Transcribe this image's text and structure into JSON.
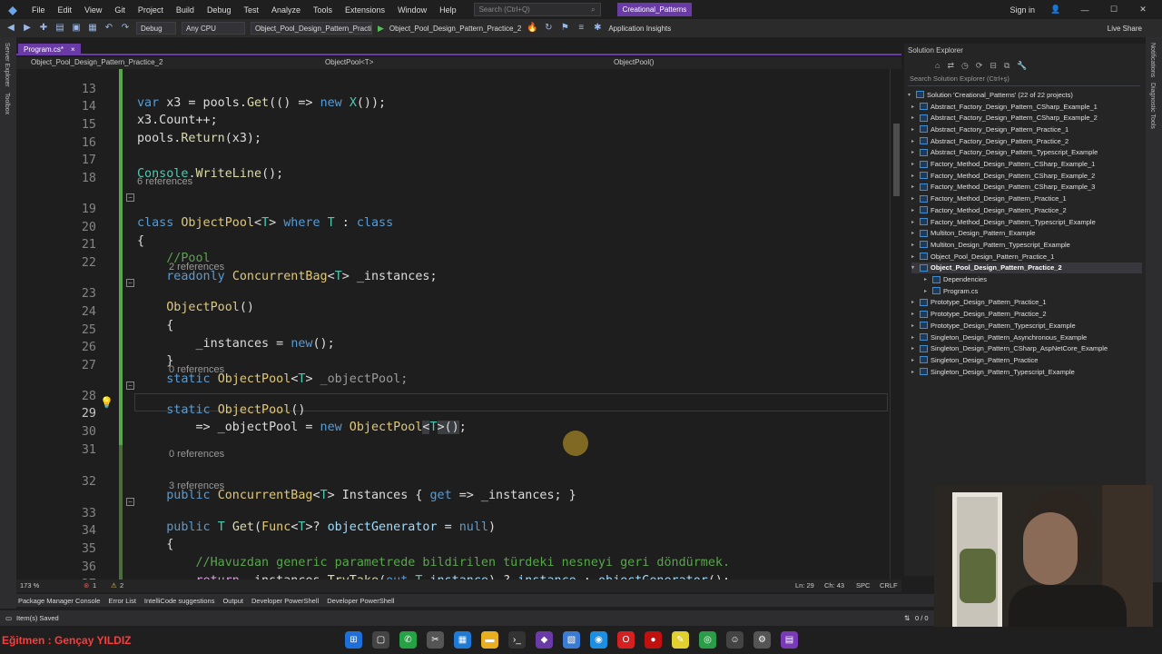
{
  "menubar": {
    "items": [
      "File",
      "Edit",
      "View",
      "Git",
      "Project",
      "Build",
      "Debug",
      "Test",
      "Analyze",
      "Tools",
      "Extensions",
      "Window",
      "Help"
    ],
    "search_placeholder": "Search (Ctrl+Q)",
    "solution_name": "Creational_Patterns",
    "sign_in": "Sign in"
  },
  "toolbar": {
    "config": "Debug",
    "platform": "Any CPU",
    "startup_project": "Object_Pool_Design_Pattern_Practi",
    "run_target": "Object_Pool_Design_Pattern_Practice_2",
    "app_insights": "Application Insights",
    "live_share": "Live Share"
  },
  "left_strip": [
    "Server Explorer",
    "Toolbox"
  ],
  "right_strip": [
    "Notifications",
    "Diagnostic Tools"
  ],
  "editor": {
    "tab_label": "Program.cs*",
    "tab_close": "×",
    "nav_project": "Object_Pool_Design_Pattern_Practice_2",
    "nav_class": "ObjectPool<T>",
    "nav_member": "ObjectPool()",
    "lenses": [
      "6 references",
      "2 references",
      "0 references",
      "0 references",
      "3 references"
    ],
    "line_numbers": [
      "13",
      "14",
      "15",
      "16",
      "17",
      "18",
      "19",
      "20",
      "21",
      "22",
      "23",
      "24",
      "25",
      "26",
      "27",
      "28",
      "29",
      "30",
      "31",
      "32",
      "33",
      "34",
      "35",
      "36",
      "37"
    ]
  },
  "editor_status": {
    "zoom": "173 %",
    "errors": "1",
    "warnings": "2",
    "line": "Ln: 29",
    "col": "Ch: 43",
    "spc": "SPC",
    "eol": "CRLF",
    "solution_tab": "Solution"
  },
  "solution_explorer": {
    "title": "Solution Explorer",
    "search_placeholder": "Search Solution Explorer (Ctrl+ş)",
    "solution_node": "Solution 'Creational_Patterns' (22 of 22 projects)",
    "projects": [
      "Abstract_Factory_Design_Pattern_CSharp_Example_1",
      "Abstract_Factory_Design_Pattern_CSharp_Example_2",
      "Abstract_Factory_Design_Pattern_Practice_1",
      "Abstract_Factory_Design_Pattern_Practice_2",
      "Abstract_Factory_Design_Pattern_Typescript_Example",
      "Factory_Method_Design_Pattern_CSharp_Example_1",
      "Factory_Method_Design_Pattern_CSharp_Example_2",
      "Factory_Method_Design_Pattern_CSharp_Example_3",
      "Factory_Method_Design_Pattern_Practice_1",
      "Factory_Method_Design_Pattern_Practice_2",
      "Factory_Method_Design_Pattern_Typescript_Example",
      "Multiton_Design_Pattern_Example",
      "Multiton_Design_Pattern_Typescript_Example",
      "Object_Pool_Design_Pattern_Practice_1",
      "Object_Pool_Design_Pattern_Practice_2",
      "Dependencies",
      "Program.cs",
      "Prototype_Design_Pattern_Practice_1",
      "Prototype_Design_Pattern_Practice_2",
      "Prototype_Design_Pattern_Typescript_Example",
      "Singleton_Design_Pattern_Asynchronous_Example",
      "Singleton_Design_Pattern_CSharp_AspNetCore_Example",
      "Singleton_Design_Pattern_Practice",
      "Singleton_Design_Pattern_Typescript_Example"
    ],
    "selected": "Object_Pool_Design_Pattern_Practice_2"
  },
  "tool_tabs": [
    "Package Manager Console",
    "Error List",
    "IntelliCode suggestions",
    "Output",
    "Developer PowerShell",
    "Developer PowerShell"
  ],
  "statusbar": {
    "message": "Item(s) Saved",
    "git": "0 / 0"
  },
  "overlay": {
    "teacher": "Eğitmen : Gençay YILDIZ"
  },
  "colors": {
    "accent": "#6a3aa7",
    "change_bar": "#57a64a",
    "teacher_text": "#ff3b3b"
  }
}
